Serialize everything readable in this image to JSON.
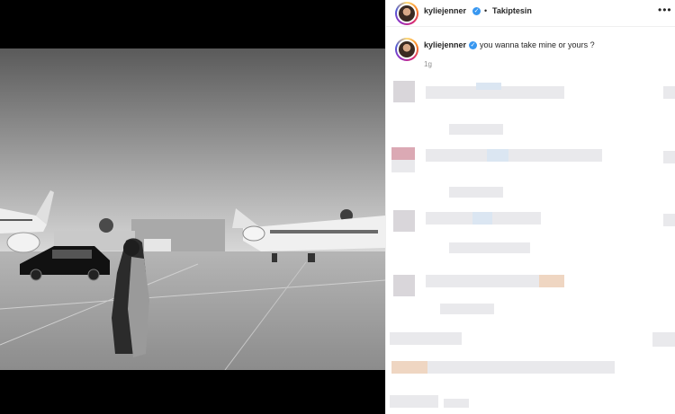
{
  "post": {
    "author": "kyliejenner",
    "follow_status": "Takiptesin",
    "separator": "•",
    "more_icon": "more-horizontal-icon",
    "verified_icon": "verified-badge-icon"
  },
  "caption": {
    "author": "kyliejenner",
    "text": "you wanna take mine or yours ?",
    "time": "1g"
  }
}
